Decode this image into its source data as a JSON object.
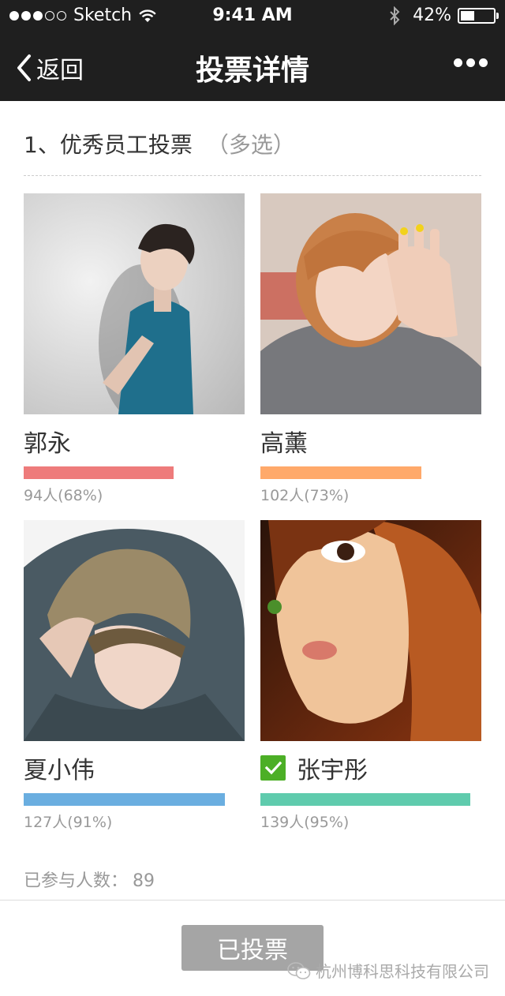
{
  "status_bar": {
    "carrier": "Sketch",
    "time": "9:41 AM",
    "battery_text": "42%",
    "battery_level": 0.42,
    "signal_bars_filled": 3,
    "signal_bars_total": 5
  },
  "nav": {
    "back_label": "返回",
    "title": "投票详情",
    "back_icon": "chevron-left-icon",
    "more_icon": "more-dots-icon"
  },
  "question": {
    "text": "1、优秀员工投票",
    "mode": "（多选）"
  },
  "candidates": [
    {
      "name": "郭永",
      "stat": "94人(68%)",
      "fraction": 0.68,
      "color": "#ee7b7b",
      "checked": false
    },
    {
      "name": "高薰",
      "stat": "102人(73%)",
      "fraction": 0.73,
      "color": "#ffa96a",
      "checked": false
    },
    {
      "name": "夏小伟",
      "stat": "127人(91%)",
      "fraction": 0.91,
      "color": "#6aaee0",
      "checked": false
    },
    {
      "name": "张宇彤",
      "stat": "139人(95%)",
      "fraction": 0.95,
      "color": "#5fcbad",
      "checked": true
    }
  ],
  "participants": {
    "label": "已参与人数：",
    "count": "89"
  },
  "vote_button": {
    "label": "已投票"
  },
  "watermark": {
    "text": "杭州博科思科技有限公司",
    "icon": "wechat-icon"
  },
  "colors": {
    "header_bg": "#1f1f1f",
    "check_green": "#4caf26",
    "button_gray": "#a5a5a5"
  }
}
